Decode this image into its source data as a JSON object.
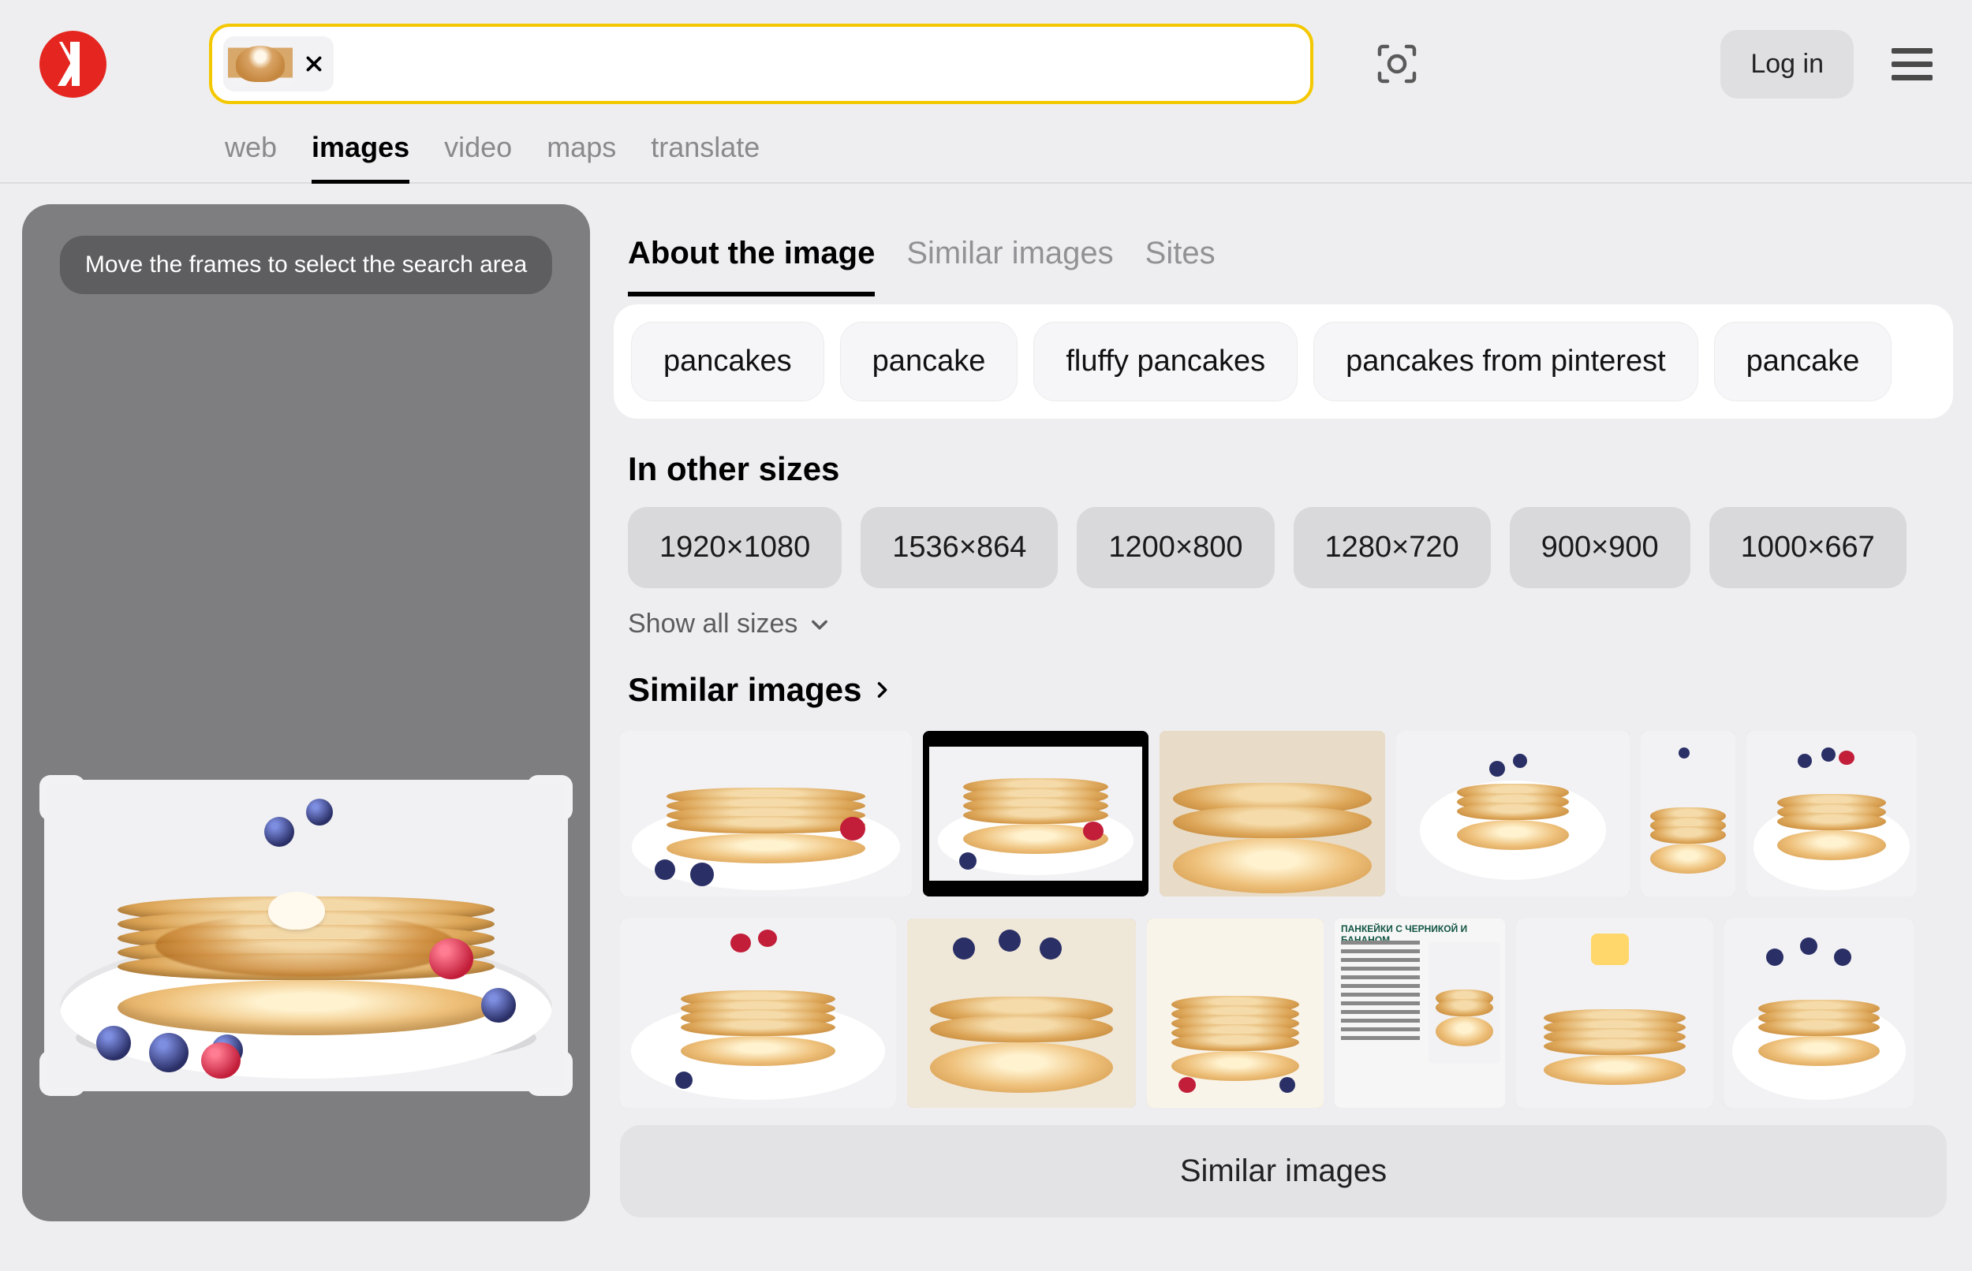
{
  "header": {
    "login_label": "Log in"
  },
  "nav_tabs": {
    "web": "web",
    "images": "images",
    "video": "video",
    "maps": "maps",
    "translate": "translate"
  },
  "crop_hint": "Move the frames to select the search area",
  "result_tabs": {
    "about": "About the image",
    "similar": "Similar images",
    "sites": "Sites"
  },
  "tags": [
    "pancakes",
    "pancake",
    "fluffy pancakes",
    "pancakes from pinterest",
    "pancake"
  ],
  "sizes_title": "In other sizes",
  "sizes": [
    "1920×1080",
    "1536×864",
    "1200×800",
    "1280×720",
    "900×900",
    "1000×667"
  ],
  "show_all_sizes": "Show all sizes",
  "similar_title": "Similar images",
  "similar_button": "Similar images",
  "textcard_title": "ПАНКЕЙКИ С ЧЕРНИКОЙ И БАНАНОМ"
}
